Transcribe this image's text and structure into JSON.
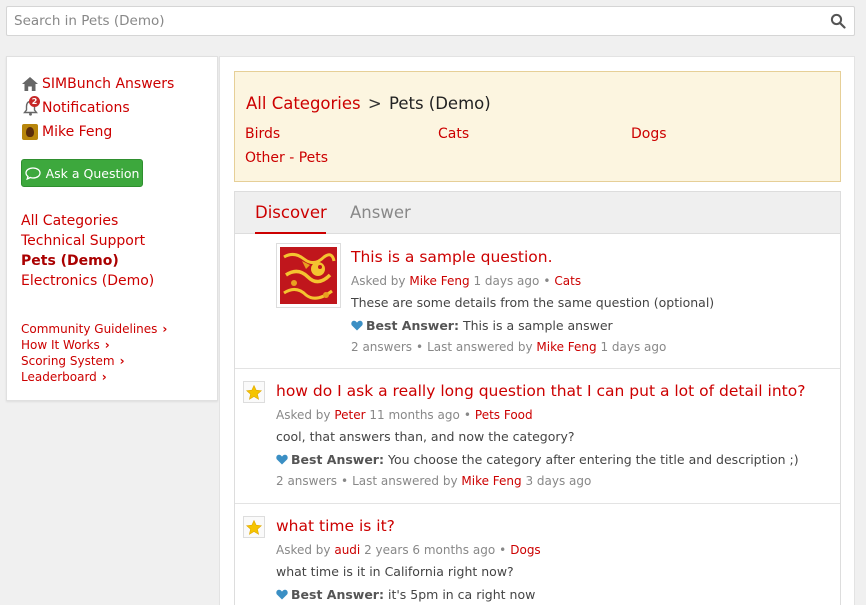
{
  "search": {
    "placeholder": "Search in Pets (Demo)"
  },
  "sidebar": {
    "home_label": "SIMBunch Answers",
    "notifications_label": "Notifications",
    "notifications_count": "2",
    "user_label": "Mike Feng",
    "ask_button": "Ask a Question",
    "categories": [
      "All Categories",
      "Technical Support",
      "Pets (Demo)",
      "Electronics (Demo)"
    ],
    "guides": [
      "Community Guidelines",
      "How It Works",
      "Scoring System",
      "Leaderboard"
    ]
  },
  "category_box": {
    "breadcrumb_root": "All Categories",
    "breadcrumb_sep": ">",
    "breadcrumb_current": "Pets (Demo)",
    "subcategories": [
      "Birds",
      "Cats",
      "Dogs",
      "Other - Pets"
    ]
  },
  "tabs": {
    "discover": "Discover",
    "answer": "Answer"
  },
  "questions": [
    {
      "title": "This is a sample question.",
      "asked_prefix": "Asked by",
      "author": "Mike Feng",
      "time": "1 days ago",
      "category": "Cats",
      "details": "These are some details from the same question (optional)",
      "best_label": "Best Answer:",
      "best_text": "This is a sample answer",
      "answers": "2 answers",
      "last_prefix": "Last answered by",
      "last_user": "Mike Feng",
      "last_time": "1 days ago"
    },
    {
      "title": "how do I ask a really long question that I can put a lot of detail into?",
      "asked_prefix": "Asked by",
      "author": "Peter",
      "time": "11 months ago",
      "category": "Pets Food",
      "details": "cool, that answers than, and now the category?",
      "best_label": "Best Answer:",
      "best_text": "You choose the category after entering the title and description ;)",
      "answers": "2 answers",
      "last_prefix": "Last answered by",
      "last_user": "Mike Feng",
      "last_time": "3 days ago"
    },
    {
      "title": "what time is it?",
      "asked_prefix": "Asked by",
      "author": "audi",
      "time": "2 years 6 months ago",
      "category": "Dogs",
      "details": "what time is it in California right now?",
      "best_label": "Best Answer:",
      "best_text": "it's 5pm in ca right now"
    }
  ],
  "colors": {
    "accent": "#cc0000",
    "ask_button": "#3da83d",
    "category_bg": "#fcf5e0",
    "heart": "#3b8fc4",
    "star": "#f5c400"
  }
}
